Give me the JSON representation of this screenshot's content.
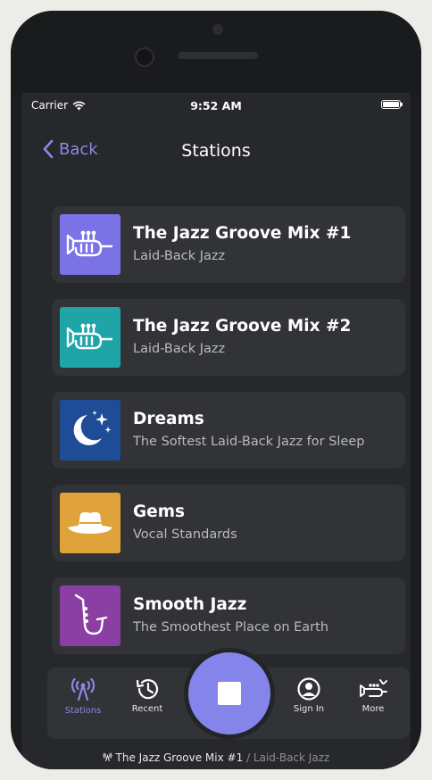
{
  "status": {
    "carrier": "Carrier",
    "time": "9:52 AM"
  },
  "nav": {
    "back_label": "Back",
    "title": "Stations"
  },
  "stations": [
    {
      "title": "The Jazz Groove Mix #1",
      "subtitle": "Laid-Back Jazz",
      "art_icon": "trumpet-icon",
      "art_color": "#7a72e6"
    },
    {
      "title": "The Jazz Groove Mix #2",
      "subtitle": "Laid-Back Jazz",
      "art_icon": "trumpet-icon",
      "art_color": "#1fa5a8"
    },
    {
      "title": "Dreams",
      "subtitle": "The Softest Laid-Back Jazz for Sleep",
      "art_icon": "moon-stars-icon",
      "art_color": "#1e4c96"
    },
    {
      "title": "Gems",
      "subtitle": "Vocal Standards",
      "art_icon": "hat-icon",
      "art_color": "#e0a23a"
    },
    {
      "title": "Smooth Jazz",
      "subtitle": "The Smoothest Place on Earth",
      "art_icon": "saxophone-icon",
      "art_color": "#8c3fa3"
    }
  ],
  "tabs": {
    "stations": "Stations",
    "recent": "Recent",
    "sign_in": "Sign In",
    "more": "More"
  },
  "now_playing": {
    "title": "The Jazz Groove Mix #1",
    "separator": "/",
    "subtitle": "Laid-Back Jazz"
  },
  "colors": {
    "accent": "#8584ea",
    "background": "#27282b",
    "card": "#323336"
  }
}
